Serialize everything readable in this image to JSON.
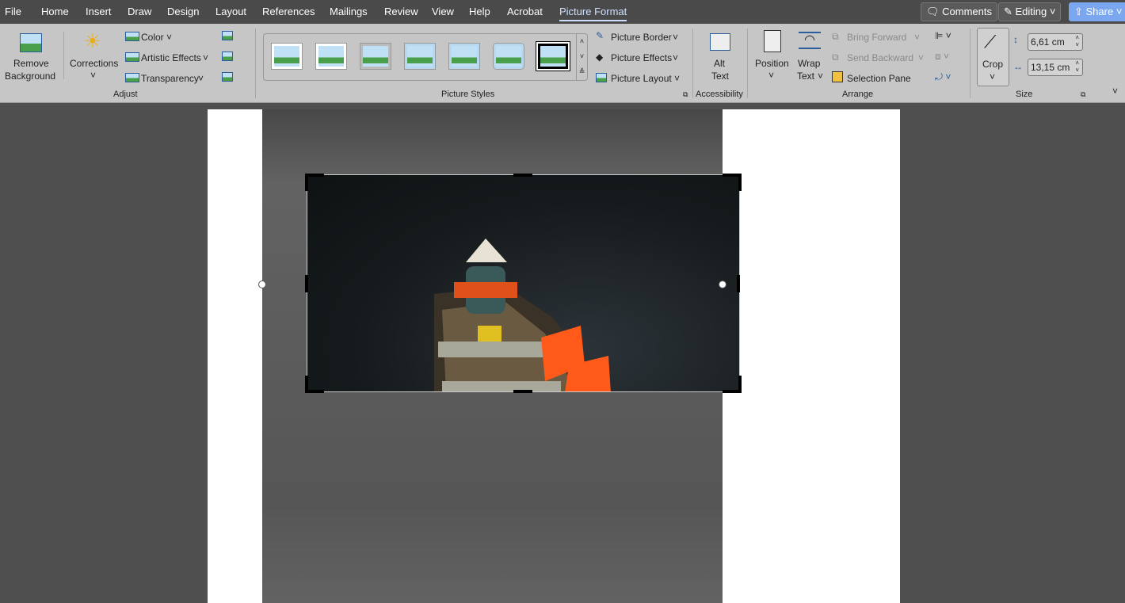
{
  "menu": {
    "tabs": [
      "File",
      "Home",
      "Insert",
      "Draw",
      "Design",
      "Layout",
      "References",
      "Mailings",
      "Review",
      "View",
      "Help",
      "Acrobat",
      "Picture Format"
    ],
    "active": "Picture Format",
    "comments": "Comments",
    "editing": "Editing",
    "share": "Share"
  },
  "ribbon": {
    "adjust": {
      "remove_background_1": "Remove",
      "remove_background_2": "Background",
      "corrections": "Corrections",
      "color": "Color",
      "artistic_effects": "Artistic Effects",
      "transparency": "Transparency",
      "group": "Adjust"
    },
    "styles": {
      "group": "Picture Styles",
      "picture_border": "Picture Border",
      "picture_effects": "Picture Effects",
      "picture_layout": "Picture Layout"
    },
    "accessibility": {
      "alt_1": "Alt",
      "alt_2": "Text",
      "group": "Accessibility"
    },
    "arrange": {
      "position": "Position",
      "wrap_1": "Wrap",
      "wrap_2": "Text",
      "bring_forward": "Bring Forward",
      "send_backward": "Send Backward",
      "selection_pane": "Selection Pane",
      "group": "Arrange"
    },
    "size": {
      "crop": "Crop",
      "height": "6,61 cm",
      "width": "13,15 cm",
      "group": "Size"
    }
  },
  "colors": {
    "accent": "#cfe0ff",
    "share": "#7aa7f0"
  }
}
